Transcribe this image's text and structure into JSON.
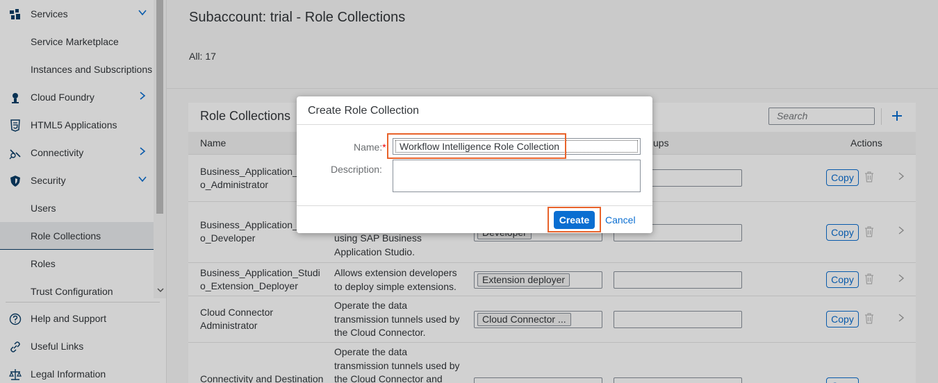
{
  "sidebar": {
    "items": [
      {
        "label": "Services",
        "icon": "services-icon",
        "chevron": "down"
      },
      {
        "label": "Service Marketplace"
      },
      {
        "label": "Instances and Subscriptions"
      },
      {
        "label": "Cloud Foundry",
        "icon": "cloud-foundry-icon",
        "chevron": "right"
      },
      {
        "label": "HTML5 Applications",
        "icon": "html5-icon"
      },
      {
        "label": "Connectivity",
        "icon": "connectivity-icon",
        "chevron": "right"
      },
      {
        "label": "Security",
        "icon": "shield-icon",
        "chevron": "down"
      },
      {
        "label": "Users"
      },
      {
        "label": "Role Collections",
        "selected": true
      },
      {
        "label": "Roles"
      },
      {
        "label": "Trust Configuration"
      }
    ],
    "bottom": [
      {
        "label": "Help and Support",
        "icon": "help-icon"
      },
      {
        "label": "Useful Links",
        "icon": "link-icon"
      },
      {
        "label": "Legal Information",
        "icon": "legal-icon"
      }
    ]
  },
  "header": {
    "title": "Subaccount: trial - Role Collections",
    "count": "All: 17"
  },
  "panel": {
    "title": "Role Collections",
    "search_placeholder": "Search",
    "columns": {
      "name": "Name",
      "groups": "ups",
      "actions": "Actions"
    },
    "rows": [
      {
        "name": "Business_Application_\no_Administrator",
        "desc": "",
        "token": "",
        "copy": "Copy"
      },
      {
        "name": "Business_Application_\no_Developer",
        "desc": "using SAP Business\nApplication Studio.",
        "token": "Developer",
        "copy": "Copy"
      },
      {
        "name": "Business_Application_Studi\no_Extension_Deployer",
        "desc": "Allows extension developers\nto deploy simple extensions.",
        "token": "Extension deployer",
        "copy": "Copy"
      },
      {
        "name": "Cloud Connector\nAdministrator",
        "desc": "Operate the data\ntransmission tunnels used by\nthe Cloud Connector.",
        "token": "Cloud Connector ...",
        "copy": "Copy"
      },
      {
        "name": "Connectivity and Destination",
        "desc": "Operate the data\ntransmission tunnels used by\nthe Cloud Connector and",
        "token": "",
        "copy": "Copy"
      }
    ]
  },
  "dialog": {
    "title": "Create Role Collection",
    "name_label": "Name:",
    "required_mark": "*",
    "name_value": "Workflow Intelligence Role Collection",
    "description_label": "Description:",
    "description_value": "",
    "create_label": "Create",
    "cancel_label": "Cancel"
  },
  "colors": {
    "accent": "#0a6ed1",
    "highlight": "#e8632b",
    "nav_dark": "#0a3d67"
  }
}
